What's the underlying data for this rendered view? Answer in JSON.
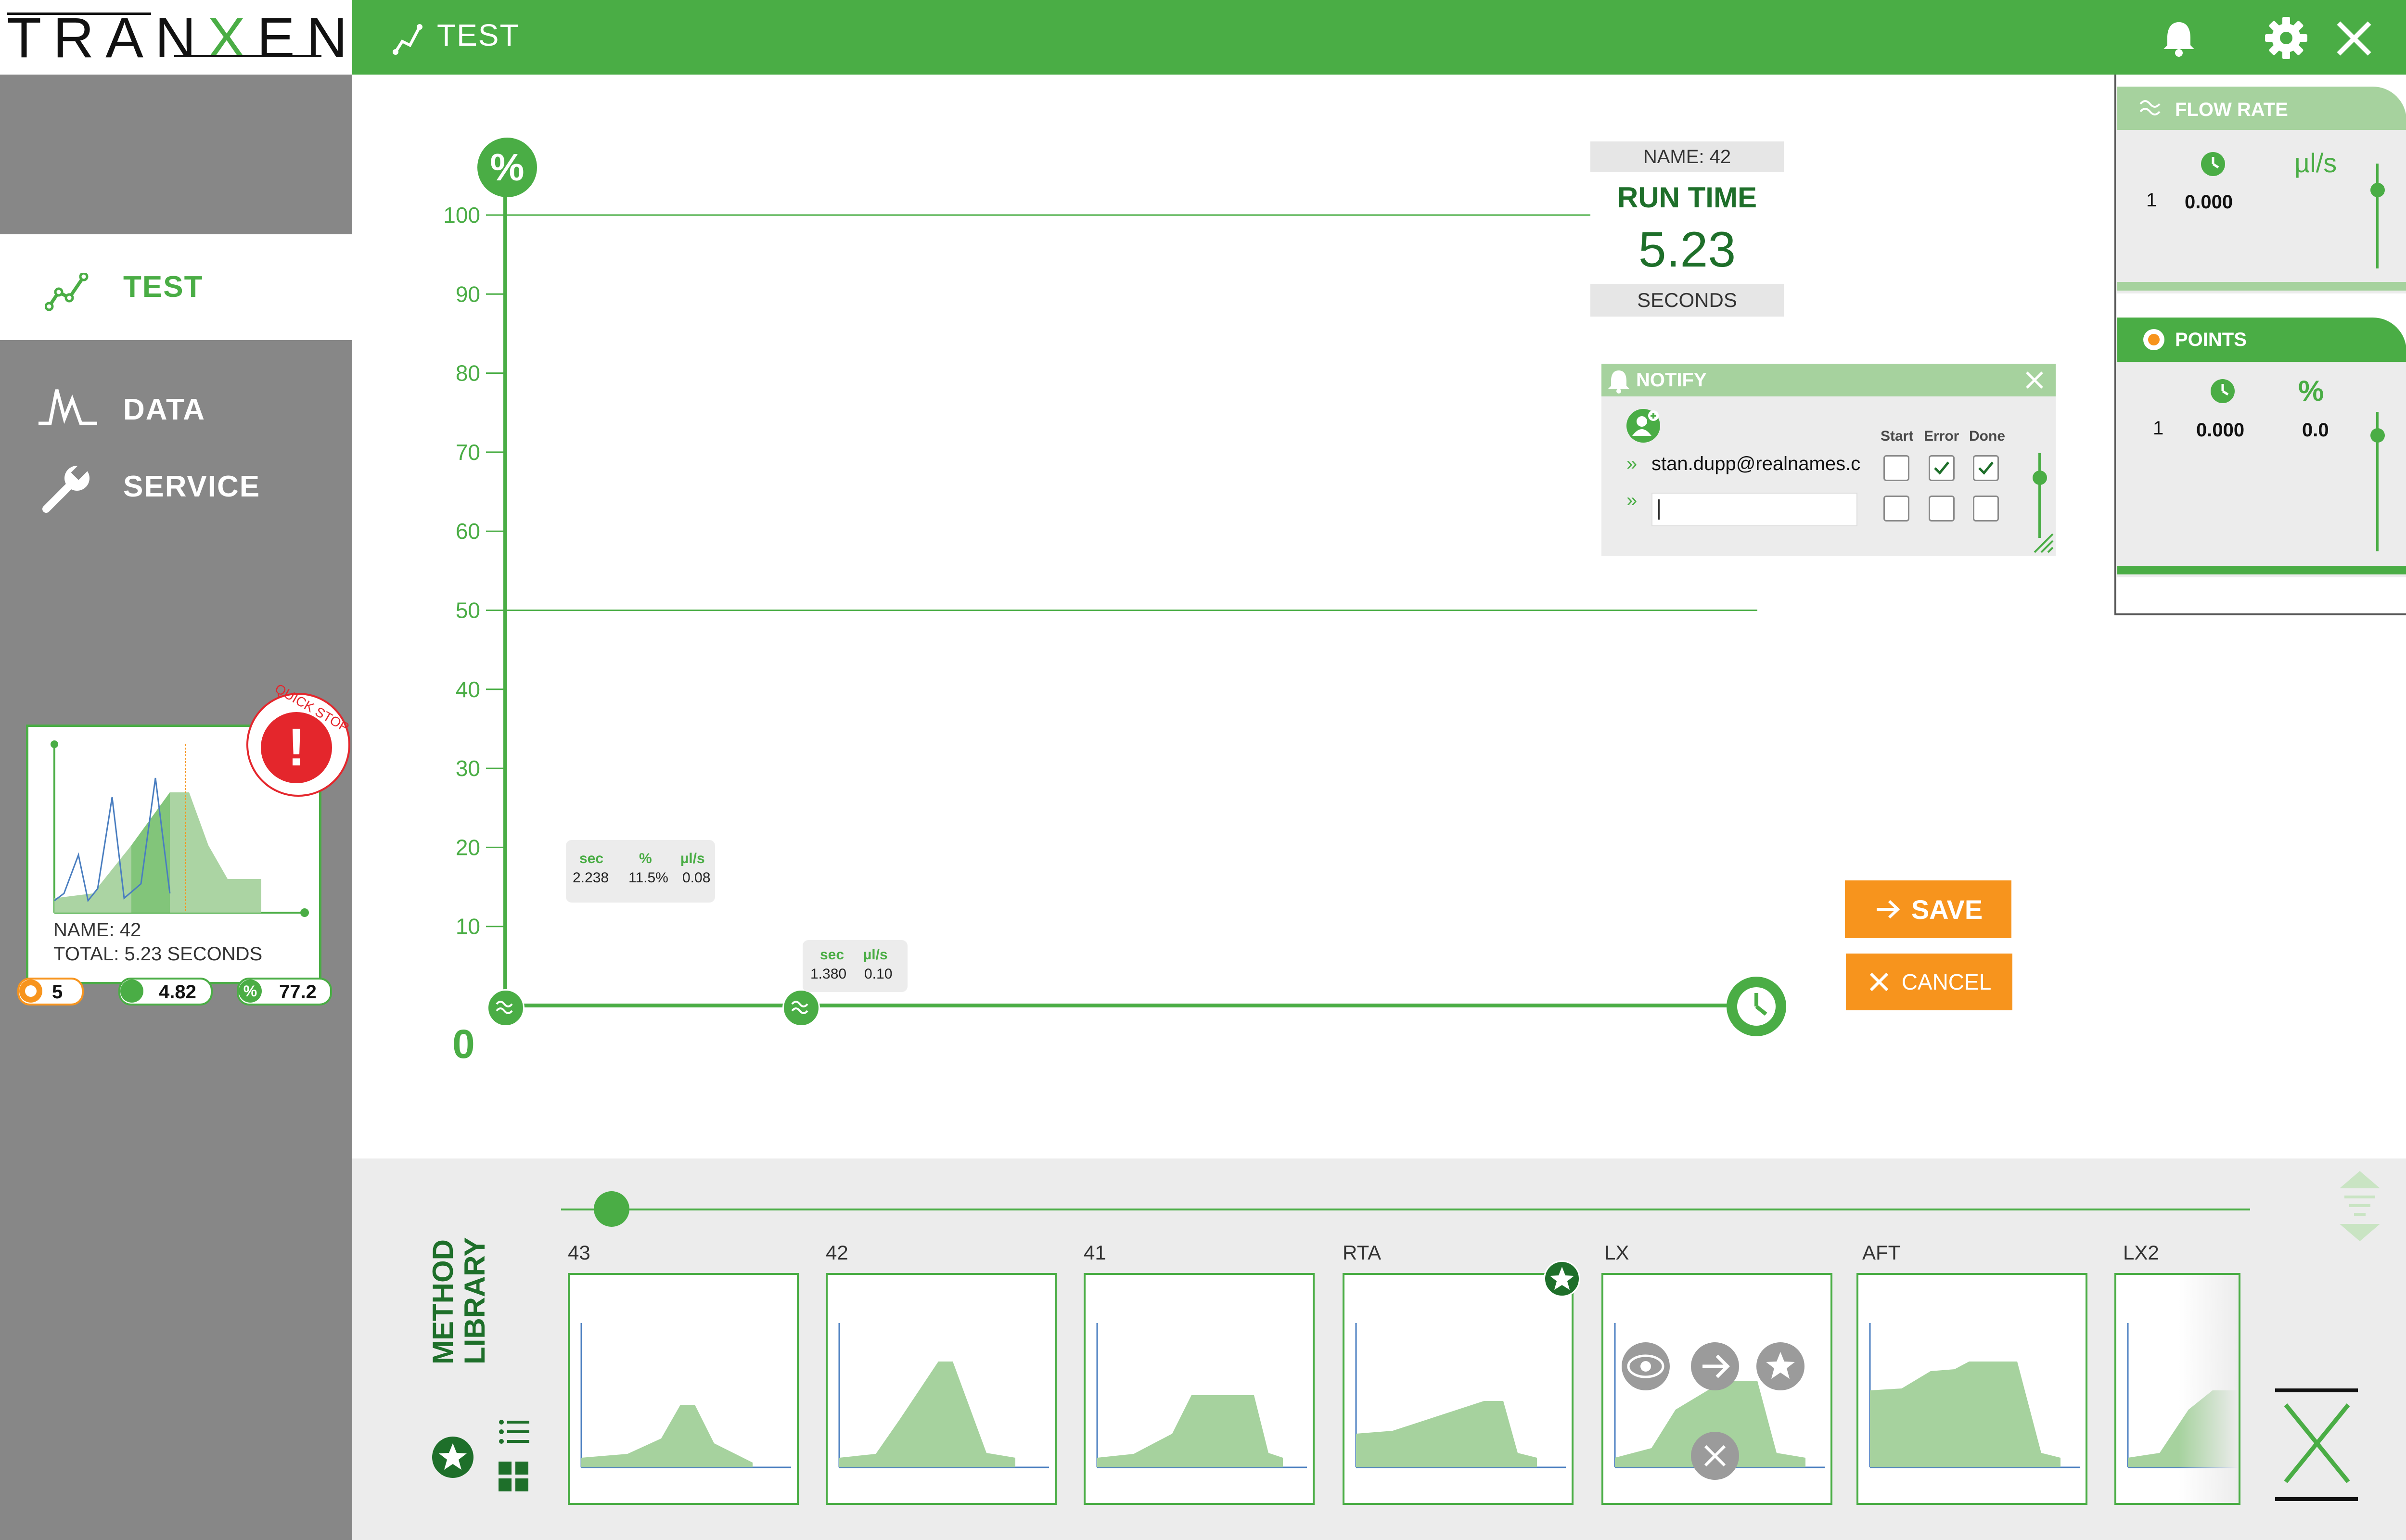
{
  "app": {
    "logo_left": "TRAN",
    "logo_x": "X",
    "logo_right": "END",
    "title": "TEST",
    "colors": {
      "accent": "#4aad45",
      "dark_green": "#1e6f2a",
      "light_green": "#a6d29e",
      "orange": "#f7941d",
      "red": "#e4262c",
      "sidebar": "#878787"
    }
  },
  "sidebar": {
    "items": [
      {
        "label": "TEST",
        "icon": "line-chart-icon",
        "active": true
      },
      {
        "label": "DATA",
        "icon": "peaks-icon",
        "active": false
      },
      {
        "label": "SERVICE",
        "icon": "wrench-icon",
        "active": false
      }
    ],
    "preview_card": {
      "badge": "QUICK STOP",
      "name": "NAME: 42",
      "total": "TOTAL:  5.23 SECONDS",
      "points": "5",
      "time": "4.82",
      "percent": "77.2"
    }
  },
  "chart": {
    "y_axis_badge": "%",
    "y_ticks": [
      "100",
      "90",
      "80",
      "70",
      "60",
      "50",
      "40",
      "30",
      "20",
      "10"
    ],
    "zero_label": "0",
    "tip_pct": {
      "h1": "sec",
      "h2": "%",
      "h3": "µl/s",
      "v1": "2.238",
      "v2": "11.5%",
      "v3": "0.08"
    },
    "tip_flow": {
      "h1": "sec",
      "h2": "µl/s",
      "v1": "1.380",
      "v2": "0.10"
    }
  },
  "chart_data": {
    "type": "line",
    "ylim": [
      0,
      100
    ],
    "y_ticks": [
      10,
      20,
      30,
      40,
      50,
      60,
      70,
      80,
      90,
      100
    ],
    "gridlines": [
      50,
      100
    ]
  },
  "runtime": {
    "name": "NAME: 42",
    "label": "RUN TIME",
    "value": "5.23",
    "unit": "SECONDS"
  },
  "notify": {
    "title": "NOTIFY",
    "col_start": "Start",
    "col_error": "Error",
    "col_done": "Done",
    "rows": [
      {
        "email": "stan.dupp@realnames.c",
        "start": false,
        "error": true,
        "done": true
      },
      {
        "email": "",
        "start": false,
        "error": false,
        "done": false
      }
    ],
    "prefix": "»"
  },
  "flow_panel": {
    "title": "FLOW RATE",
    "unit": "µl/s",
    "row_index": "1",
    "row_value": "0.000"
  },
  "points_panel": {
    "title": "POINTS",
    "unit": "%",
    "row_index": "1",
    "row_time": "0.000",
    "row_pct": "0.0"
  },
  "actions": {
    "save": "SAVE",
    "cancel": "CANCEL"
  },
  "library": {
    "title_line1": "METHOD",
    "title_line2": "LIBRARY",
    "methods": [
      "43",
      "42",
      "41",
      "RTA",
      "LX",
      "AFT",
      "LX2"
    ]
  }
}
